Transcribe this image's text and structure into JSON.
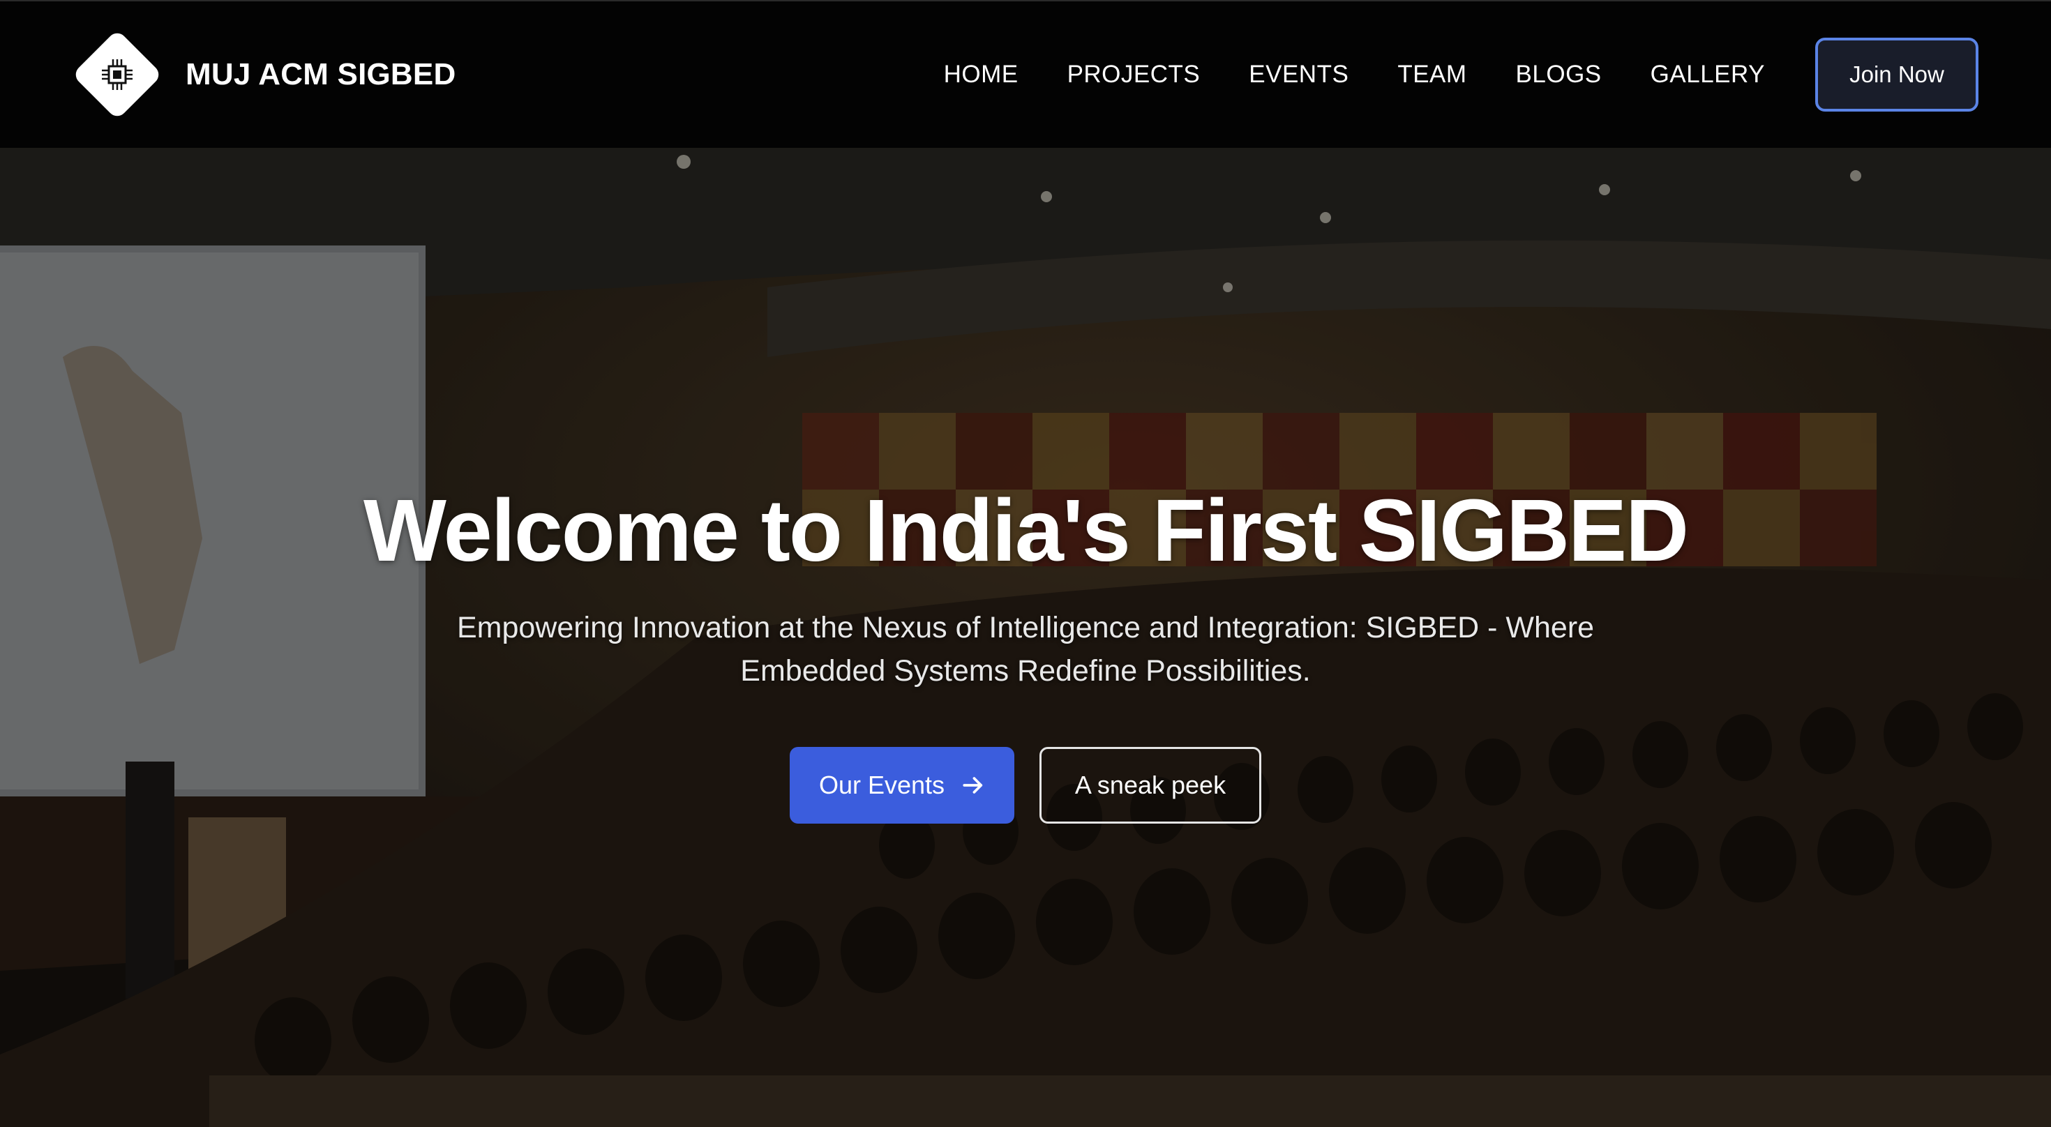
{
  "nav": {
    "brand": "MUJ ACM SIGBED",
    "logo_icon": "chip-icon",
    "links": [
      "HOME",
      "PROJECTS",
      "EVENTS",
      "TEAM",
      "BLOGS",
      "GALLERY"
    ],
    "cta": "Join Now"
  },
  "hero": {
    "title": "Welcome to India's First SIGBED",
    "subtitle": "Empowering Innovation at the Nexus of Intelligence and Integration: SIGBED - Where Embedded Systems Redefine Possibilities.",
    "primary_button": "Our Events",
    "primary_icon": "arrow-right-icon",
    "secondary_button": "A sneak peek",
    "background_image": "auditorium-photo"
  },
  "colors": {
    "nav_bg": "#030303",
    "accent": "#3b5ddd",
    "cta_border": "#5b84e6"
  }
}
